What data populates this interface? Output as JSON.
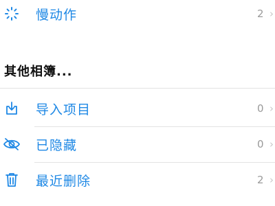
{
  "rows_top": [
    {
      "icon": "slow-motion-icon",
      "label": "慢动作",
      "count": "2"
    }
  ],
  "section": {
    "title": "其他相簿..."
  },
  "rows": [
    {
      "icon": "import-icon",
      "label": "导入项目",
      "count": "0"
    },
    {
      "icon": "hidden-eye-icon",
      "label": "已隐藏",
      "count": "0"
    },
    {
      "icon": "trash-icon",
      "label": "最近删除",
      "count": "2"
    }
  ],
  "colors": {
    "accent": "#1e88e5",
    "count": "#9a9a9a",
    "divider": "#e3e3e3"
  }
}
